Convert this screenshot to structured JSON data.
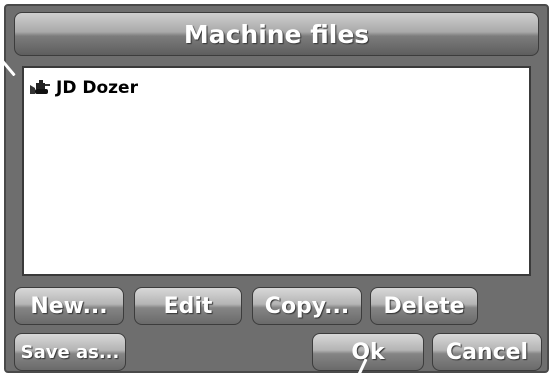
{
  "window": {
    "title": "Machine files"
  },
  "file_list": {
    "items": [
      {
        "label": "JD Dozer",
        "icon": "dozer-icon"
      }
    ]
  },
  "buttons": {
    "new_label": "New...",
    "edit_label": "Edit",
    "copy_label": "Copy...",
    "delete_label": "Delete",
    "save_as_label": "Save as...",
    "ok_label": "Ok",
    "cancel_label": "Cancel"
  },
  "colors": {
    "frame": "#6e6e6e",
    "button_text": "#ffffff",
    "list_background": "#ffffff"
  }
}
